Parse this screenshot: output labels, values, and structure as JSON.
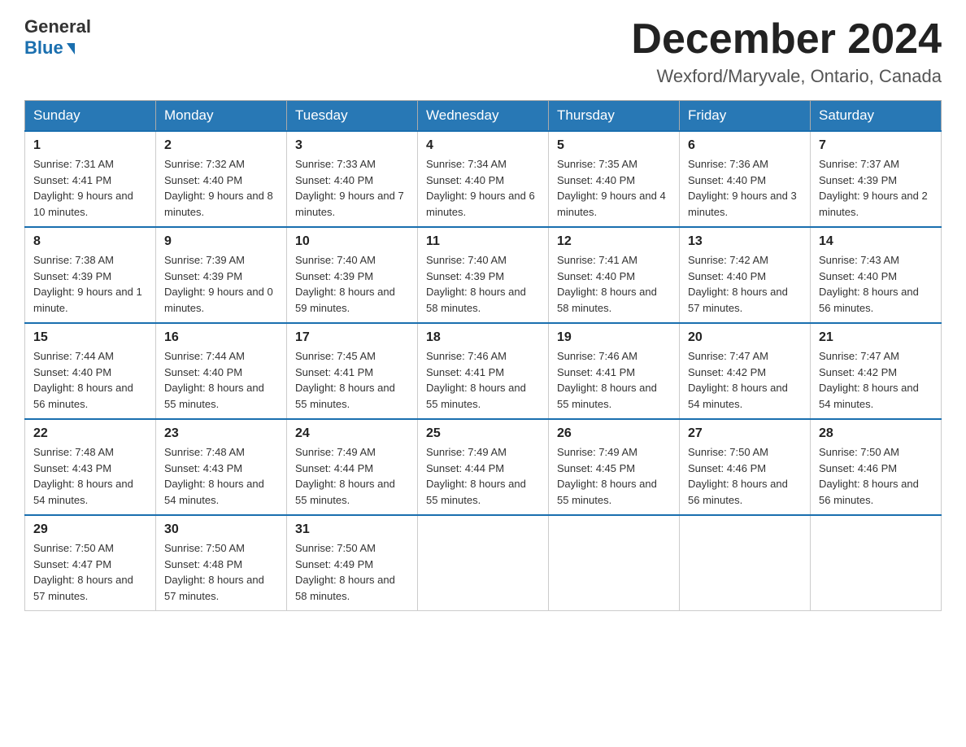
{
  "header": {
    "logo_general": "General",
    "logo_blue": "Blue",
    "month_title": "December 2024",
    "location": "Wexford/Maryvale, Ontario, Canada"
  },
  "days_of_week": [
    "Sunday",
    "Monday",
    "Tuesday",
    "Wednesday",
    "Thursday",
    "Friday",
    "Saturday"
  ],
  "weeks": [
    [
      {
        "day": "1",
        "sunrise": "7:31 AM",
        "sunset": "4:41 PM",
        "daylight": "9 hours and 10 minutes."
      },
      {
        "day": "2",
        "sunrise": "7:32 AM",
        "sunset": "4:40 PM",
        "daylight": "9 hours and 8 minutes."
      },
      {
        "day": "3",
        "sunrise": "7:33 AM",
        "sunset": "4:40 PM",
        "daylight": "9 hours and 7 minutes."
      },
      {
        "day": "4",
        "sunrise": "7:34 AM",
        "sunset": "4:40 PM",
        "daylight": "9 hours and 6 minutes."
      },
      {
        "day": "5",
        "sunrise": "7:35 AM",
        "sunset": "4:40 PM",
        "daylight": "9 hours and 4 minutes."
      },
      {
        "day": "6",
        "sunrise": "7:36 AM",
        "sunset": "4:40 PM",
        "daylight": "9 hours and 3 minutes."
      },
      {
        "day": "7",
        "sunrise": "7:37 AM",
        "sunset": "4:39 PM",
        "daylight": "9 hours and 2 minutes."
      }
    ],
    [
      {
        "day": "8",
        "sunrise": "7:38 AM",
        "sunset": "4:39 PM",
        "daylight": "9 hours and 1 minute."
      },
      {
        "day": "9",
        "sunrise": "7:39 AM",
        "sunset": "4:39 PM",
        "daylight": "9 hours and 0 minutes."
      },
      {
        "day": "10",
        "sunrise": "7:40 AM",
        "sunset": "4:39 PM",
        "daylight": "8 hours and 59 minutes."
      },
      {
        "day": "11",
        "sunrise": "7:40 AM",
        "sunset": "4:39 PM",
        "daylight": "8 hours and 58 minutes."
      },
      {
        "day": "12",
        "sunrise": "7:41 AM",
        "sunset": "4:40 PM",
        "daylight": "8 hours and 58 minutes."
      },
      {
        "day": "13",
        "sunrise": "7:42 AM",
        "sunset": "4:40 PM",
        "daylight": "8 hours and 57 minutes."
      },
      {
        "day": "14",
        "sunrise": "7:43 AM",
        "sunset": "4:40 PM",
        "daylight": "8 hours and 56 minutes."
      }
    ],
    [
      {
        "day": "15",
        "sunrise": "7:44 AM",
        "sunset": "4:40 PM",
        "daylight": "8 hours and 56 minutes."
      },
      {
        "day": "16",
        "sunrise": "7:44 AM",
        "sunset": "4:40 PM",
        "daylight": "8 hours and 55 minutes."
      },
      {
        "day": "17",
        "sunrise": "7:45 AM",
        "sunset": "4:41 PM",
        "daylight": "8 hours and 55 minutes."
      },
      {
        "day": "18",
        "sunrise": "7:46 AM",
        "sunset": "4:41 PM",
        "daylight": "8 hours and 55 minutes."
      },
      {
        "day": "19",
        "sunrise": "7:46 AM",
        "sunset": "4:41 PM",
        "daylight": "8 hours and 55 minutes."
      },
      {
        "day": "20",
        "sunrise": "7:47 AM",
        "sunset": "4:42 PM",
        "daylight": "8 hours and 54 minutes."
      },
      {
        "day": "21",
        "sunrise": "7:47 AM",
        "sunset": "4:42 PM",
        "daylight": "8 hours and 54 minutes."
      }
    ],
    [
      {
        "day": "22",
        "sunrise": "7:48 AM",
        "sunset": "4:43 PM",
        "daylight": "8 hours and 54 minutes."
      },
      {
        "day": "23",
        "sunrise": "7:48 AM",
        "sunset": "4:43 PM",
        "daylight": "8 hours and 54 minutes."
      },
      {
        "day": "24",
        "sunrise": "7:49 AM",
        "sunset": "4:44 PM",
        "daylight": "8 hours and 55 minutes."
      },
      {
        "day": "25",
        "sunrise": "7:49 AM",
        "sunset": "4:44 PM",
        "daylight": "8 hours and 55 minutes."
      },
      {
        "day": "26",
        "sunrise": "7:49 AM",
        "sunset": "4:45 PM",
        "daylight": "8 hours and 55 minutes."
      },
      {
        "day": "27",
        "sunrise": "7:50 AM",
        "sunset": "4:46 PM",
        "daylight": "8 hours and 56 minutes."
      },
      {
        "day": "28",
        "sunrise": "7:50 AM",
        "sunset": "4:46 PM",
        "daylight": "8 hours and 56 minutes."
      }
    ],
    [
      {
        "day": "29",
        "sunrise": "7:50 AM",
        "sunset": "4:47 PM",
        "daylight": "8 hours and 57 minutes."
      },
      {
        "day": "30",
        "sunrise": "7:50 AM",
        "sunset": "4:48 PM",
        "daylight": "8 hours and 57 minutes."
      },
      {
        "day": "31",
        "sunrise": "7:50 AM",
        "sunset": "4:49 PM",
        "daylight": "8 hours and 58 minutes."
      },
      null,
      null,
      null,
      null
    ]
  ]
}
